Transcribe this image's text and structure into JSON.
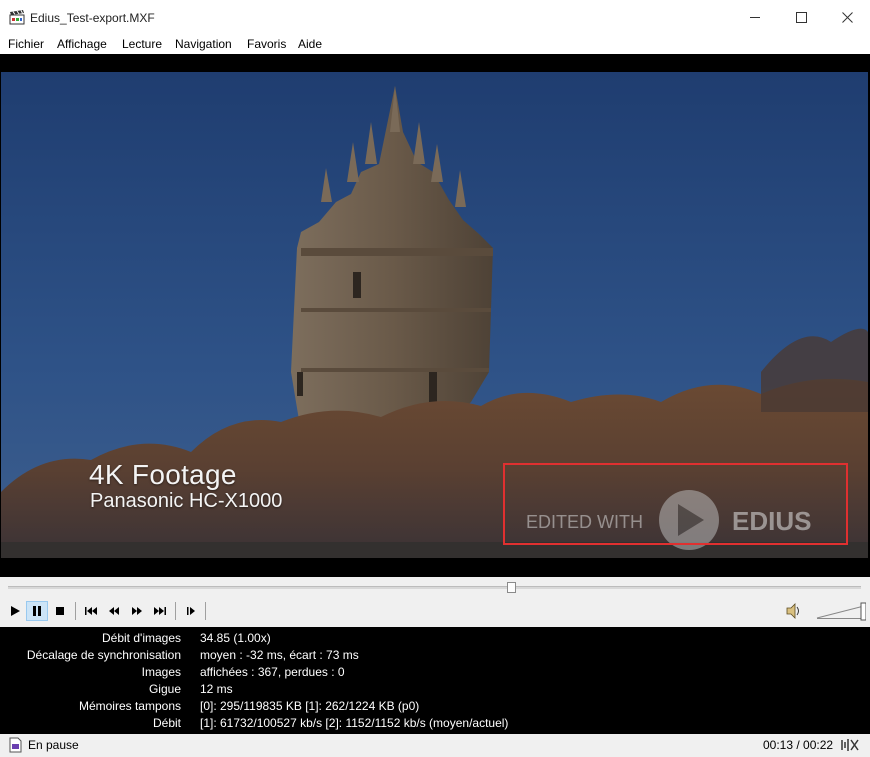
{
  "window": {
    "title": "Edius_Test-export.MXF"
  },
  "menu": [
    {
      "id": "fichier",
      "label": "Fichier"
    },
    {
      "id": "affichage",
      "label": "Affichage"
    },
    {
      "id": "lecture",
      "label": "Lecture"
    },
    {
      "id": "navigation",
      "label": "Navigation"
    },
    {
      "id": "favoris",
      "label": "Favoris"
    },
    {
      "id": "aide",
      "label": "Aide"
    }
  ],
  "video": {
    "caption_title": "4K Footage",
    "caption_subtitle": "Panasonic HC-X1000",
    "watermark_text": "EDITED WITH",
    "watermark_brand": "EDIUS",
    "highlight_color": "#e03030"
  },
  "playback": {
    "seek_position_fraction": 0.59,
    "volume_level_fraction": 1.0
  },
  "stats": [
    {
      "label": "Débit d'images",
      "value": "34.85 (1.00x)"
    },
    {
      "label": "Décalage de synchronisation",
      "value": "moyen : -32 ms, écart : 73 ms"
    },
    {
      "label": "Images",
      "value": "affichées : 367, perdues : 0"
    },
    {
      "label": "Gigue",
      "value": "12 ms"
    },
    {
      "label": "Mémoires tampons",
      "value": "[0]: 295/119835 KB [1]: 262/1224 KB (p0)"
    },
    {
      "label": "Débit",
      "value": "[1]: 61732/100527 kb/s [2]: 1152/1152 kb/s (moyen/actuel)"
    }
  ],
  "status": {
    "state": "En pause",
    "time": "00:13 / 00:22"
  }
}
